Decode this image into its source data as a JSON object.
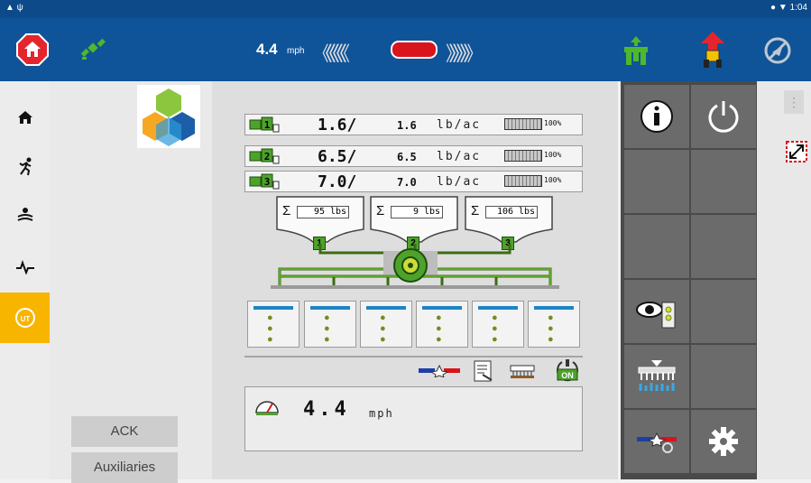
{
  "statusbar": {
    "time": "1:04"
  },
  "topbar": {
    "speed_value": "4.4",
    "speed_unit": "mph",
    "chevrons_left": "《《《《《《",
    "chevrons_right": "》》》》》》",
    "colors": {
      "bar": "#0f5499",
      "home": "#e3262e",
      "lever": "#d9141c",
      "gps": "#4eb82a"
    },
    "icons": [
      "home-icon",
      "gps-satellite-icon",
      "implement-lift-icon",
      "tractor-raise-icon",
      "no-gps-icon"
    ]
  },
  "sidenav": {
    "items": [
      {
        "name": "home-icon",
        "active": false
      },
      {
        "name": "runner-icon",
        "active": false
      },
      {
        "name": "field-icon",
        "active": false
      },
      {
        "name": "pulse-icon",
        "active": false
      },
      {
        "name": "isobus-ut-icon",
        "active": true
      }
    ]
  },
  "left": {
    "ack_label": "ACK",
    "aux_label": "Auxiliaries"
  },
  "rates": [
    {
      "id": "1",
      "actual": "1.6/",
      "target": "1.6",
      "unit": "lb/ac",
      "percent": "100%"
    },
    {
      "id": "2",
      "actual": "6.5/",
      "target": "6.5",
      "unit": "lb/ac",
      "percent": "100%"
    },
    {
      "id": "3",
      "actual": "7.0/",
      "target": "7.0",
      "unit": "lb/ac",
      "percent": "100%"
    }
  ],
  "hoppers": [
    {
      "sum": "Σ",
      "value": "95",
      "unit": "lbs",
      "id": "1"
    },
    {
      "sum": "Σ",
      "value": "9",
      "unit": "lbs",
      "id": "2"
    },
    {
      "sum": "Σ",
      "value": "106",
      "unit": "lbs",
      "id": "3"
    }
  ],
  "row_count": 6,
  "tools": [
    "section-control-icon",
    "checklist-icon",
    "seedbar-icon",
    "on-switch-icon"
  ],
  "on_label": "ON",
  "ground_speed": {
    "value": "4.4",
    "unit": "mph"
  },
  "softkeys": [
    "info-icon",
    "power-icon",
    "",
    "",
    "",
    "",
    "",
    "",
    "seed-view-icon",
    "",
    "metering-icon",
    "",
    "section-gear-icon",
    "settings-gear-icon"
  ]
}
